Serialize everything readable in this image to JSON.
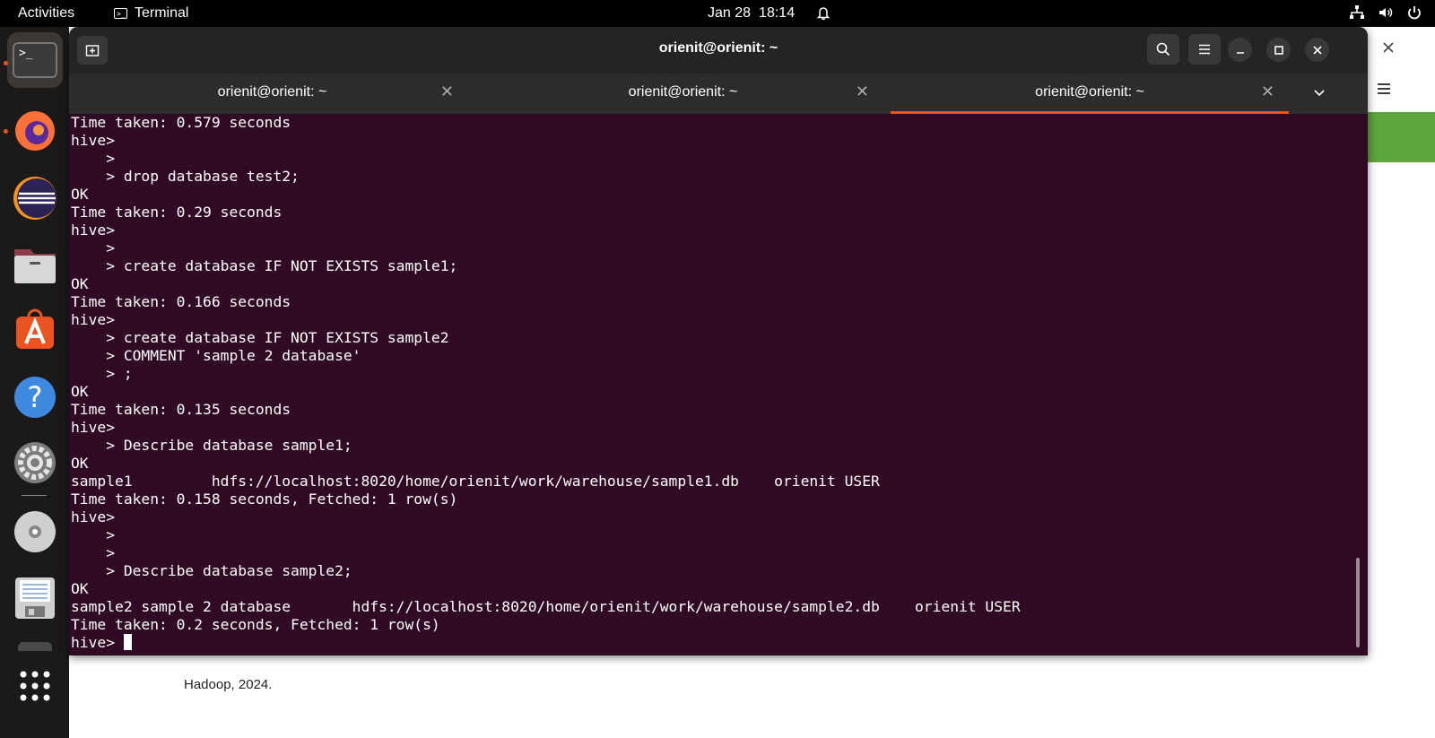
{
  "topbar": {
    "activities": "Activities",
    "app_name": "Terminal",
    "date": "Jan 28",
    "time": "18:14"
  },
  "dock": {
    "items": [
      {
        "name": "terminal",
        "running": true,
        "active": true
      },
      {
        "name": "firefox",
        "running": true
      },
      {
        "name": "eclipse"
      },
      {
        "name": "files"
      },
      {
        "name": "app-center"
      },
      {
        "name": "help"
      },
      {
        "name": "settings"
      },
      {
        "name": "dvd"
      },
      {
        "name": "save-disk"
      },
      {
        "name": "show-apps"
      }
    ]
  },
  "background_window": {
    "footer_text": "Hadoop, 2024."
  },
  "terminal": {
    "title": "orienit@orienit: ~",
    "tabs": [
      {
        "label": "orienit@orienit: ~",
        "active": false
      },
      {
        "label": "orienit@orienit: ~",
        "active": false
      },
      {
        "label": "orienit@orienit: ~",
        "active": true
      }
    ],
    "lines": [
      "Time taken: 0.579 seconds",
      "hive>",
      "    >",
      "    > drop database test2;",
      "OK",
      "Time taken: 0.29 seconds",
      "hive>",
      "    >",
      "    > create database IF NOT EXISTS sample1;",
      "OK",
      "Time taken: 0.166 seconds",
      "hive>",
      "    > create database IF NOT EXISTS sample2",
      "    > COMMENT 'sample 2 database'",
      "    > ;",
      "OK",
      "Time taken: 0.135 seconds",
      "hive>",
      "    > Describe database sample1;",
      "OK",
      "sample1         hdfs://localhost:8020/home/orienit/work/warehouse/sample1.db    orienit USER",
      "Time taken: 0.158 seconds, Fetched: 1 row(s)",
      "hive>",
      "    >",
      "    >",
      "    > Describe database sample2;",
      "OK",
      "sample2 sample 2 database       hdfs://localhost:8020/home/orienit/work/warehouse/sample2.db    orienit USER",
      "Time taken: 0.2 seconds, Fetched: 1 row(s)"
    ],
    "prompt": "hive> "
  }
}
